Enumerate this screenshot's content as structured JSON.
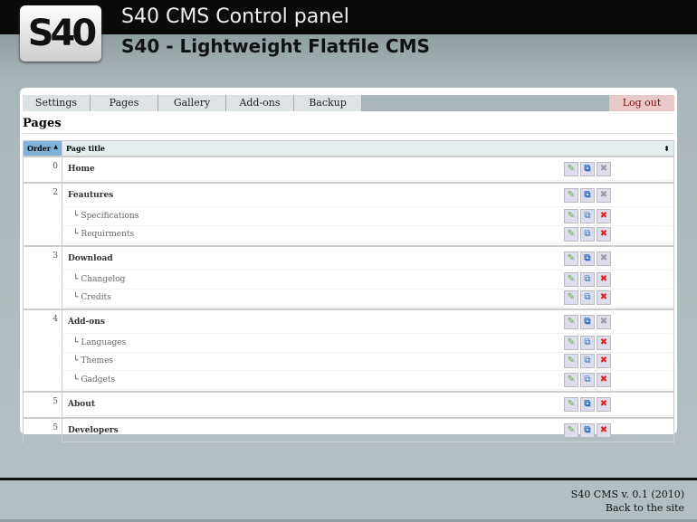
{
  "header": {
    "logo_text": "S40",
    "title": "S40 CMS Control panel",
    "subtitle": "S40 - Lightweight Flatfile CMS"
  },
  "tabs": [
    "Settings",
    "Pages",
    "Gallery",
    "Add-ons",
    "Backup"
  ],
  "logout": "Log out",
  "page_title": "Pages",
  "table": {
    "columns": [
      "Order",
      "Page title"
    ],
    "sort_up": "▲",
    "sort_both": "⬍",
    "groups": [
      {
        "order": "0",
        "pages": [
          {
            "title": "Home",
            "child": false,
            "deletable": false
          }
        ]
      },
      {
        "order": "2",
        "pages": [
          {
            "title": "Feautures",
            "child": false,
            "deletable": false
          },
          {
            "title": "Specifications",
            "child": true,
            "deletable": true
          },
          {
            "title": "Requirments",
            "child": true,
            "deletable": true
          }
        ]
      },
      {
        "order": "3",
        "pages": [
          {
            "title": "Download",
            "child": false,
            "deletable": false
          },
          {
            "title": "Changelog",
            "child": true,
            "deletable": true
          },
          {
            "title": "Credits",
            "child": true,
            "deletable": true
          }
        ]
      },
      {
        "order": "4",
        "pages": [
          {
            "title": "Add-ons",
            "child": false,
            "deletable": false
          },
          {
            "title": "Languages",
            "child": true,
            "deletable": true
          },
          {
            "title": "Themes",
            "child": true,
            "deletable": true
          },
          {
            "title": "Gadgets",
            "child": true,
            "deletable": true
          }
        ]
      },
      {
        "order": "5",
        "pages": [
          {
            "title": "About",
            "child": false,
            "deletable": true
          }
        ]
      },
      {
        "order": "5",
        "pages": [
          {
            "title": "Developers",
            "child": false,
            "deletable": true
          }
        ]
      }
    ]
  },
  "footer": {
    "version": "S40 CMS v. 0.1 (2010)",
    "back_link": "Back to the site"
  }
}
